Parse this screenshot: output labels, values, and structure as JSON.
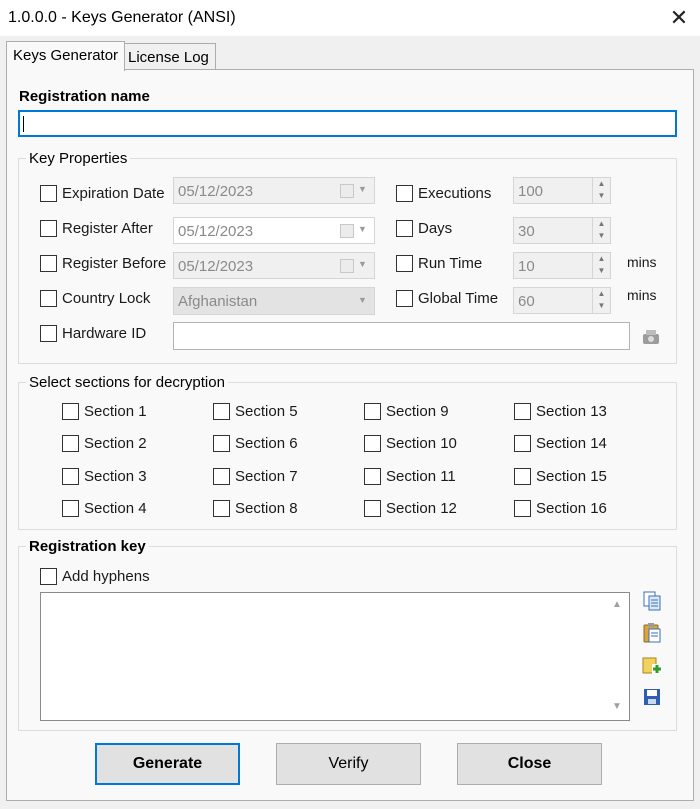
{
  "window": {
    "title": "1.0.0.0 - Keys Generator (ANSI)",
    "close_glyph": "✕"
  },
  "tabs": [
    {
      "label": "Keys Generator"
    },
    {
      "label": "License Log"
    }
  ],
  "registration_name": {
    "label": "Registration name",
    "value": ""
  },
  "key_properties": {
    "label": "Key Properties",
    "left": [
      {
        "label": "Expiration Date",
        "value": "05/12/2023"
      },
      {
        "label": "Register After",
        "value": "05/12/2023"
      },
      {
        "label": "Register Before",
        "value": "05/12/2023"
      },
      {
        "label": "Country Lock",
        "value": "Afghanistan"
      },
      {
        "label": "Hardware ID",
        "value": ""
      }
    ],
    "right": [
      {
        "label": "Executions",
        "value": "100",
        "unit": ""
      },
      {
        "label": "Days",
        "value": "30",
        "unit": ""
      },
      {
        "label": "Run Time",
        "value": "10",
        "unit": "mins"
      },
      {
        "label": "Global Time",
        "value": "60",
        "unit": "mins"
      }
    ]
  },
  "sections": {
    "label": "Select sections for decryption",
    "items": [
      "Section 1",
      "Section 2",
      "Section 3",
      "Section 4",
      "Section 5",
      "Section 6",
      "Section 7",
      "Section 8",
      "Section 9",
      "Section 10",
      "Section 11",
      "Section 12",
      "Section 13",
      "Section 14",
      "Section 15",
      "Section 16"
    ]
  },
  "registration_key": {
    "label": "Registration key",
    "hyphens_label": "Add hyphens",
    "value": ""
  },
  "buttons": {
    "generate": "Generate",
    "verify": "Verify",
    "close": "Close"
  },
  "colors": {
    "accent": "#0078d7",
    "panel": "#f9f9f9",
    "window": "#f0f0f0"
  }
}
